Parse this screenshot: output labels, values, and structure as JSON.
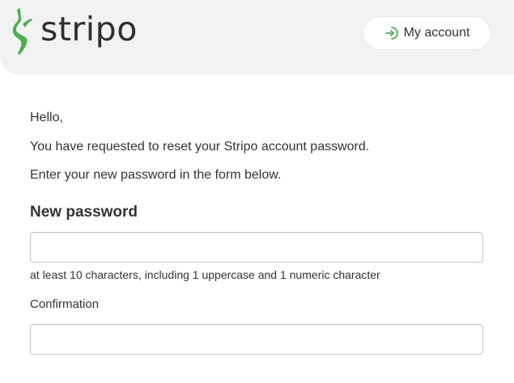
{
  "header": {
    "logo_text": "stripo",
    "logo_icon": "stripo-bolt-icon",
    "account_button_label": "My account",
    "account_button_icon": "sign-in-icon",
    "brand_color": "#4caf50",
    "background_color": "#f2f2f2"
  },
  "body": {
    "greeting": "Hello,",
    "line1": "You have requested to reset your Stripo account password.",
    "line2": "Enter your new password in the form below."
  },
  "form": {
    "new_password": {
      "heading": "New password",
      "value": "",
      "hint": "at least 10 characters, including 1 uppercase and 1 numeric character"
    },
    "confirmation": {
      "label": "Confirmation",
      "value": ""
    }
  }
}
